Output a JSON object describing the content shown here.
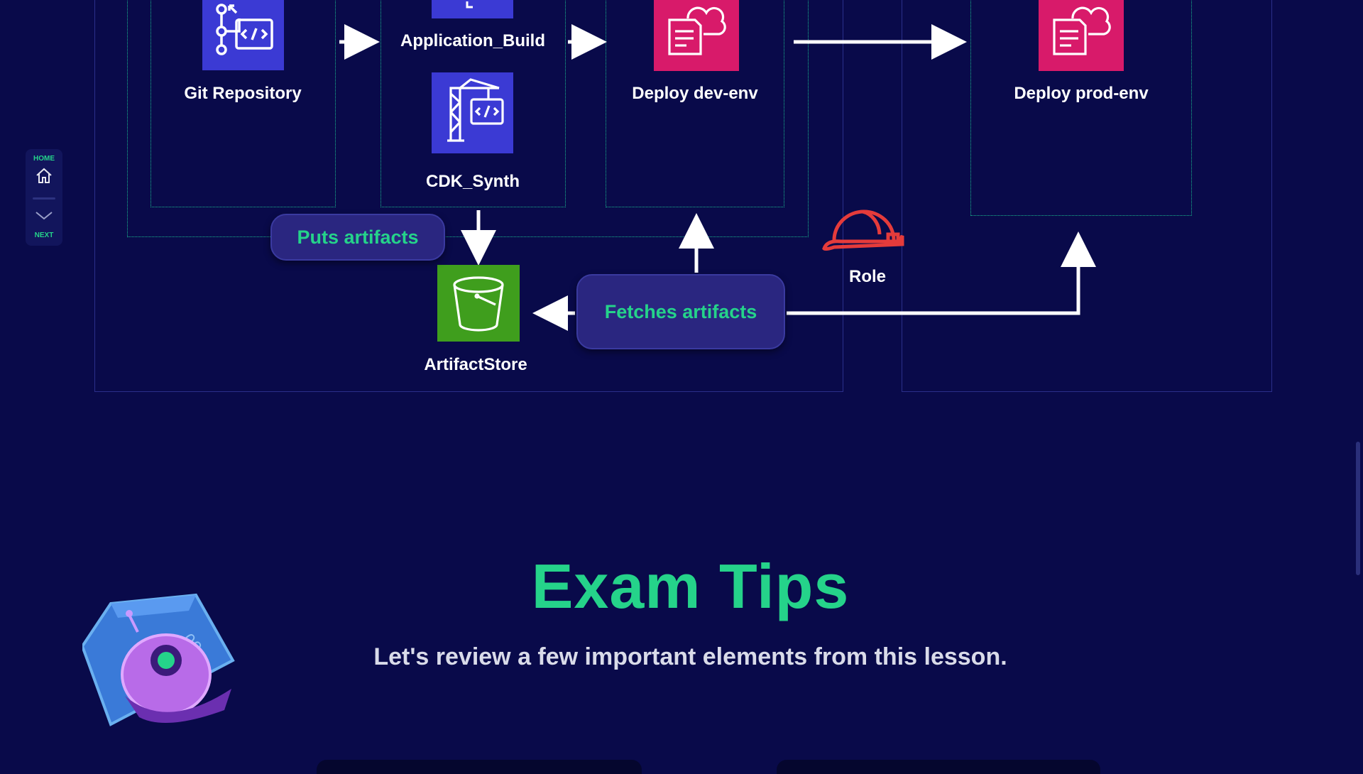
{
  "nav": {
    "home_label": "HOME",
    "next_label": "NEXT"
  },
  "diagram": {
    "nodes": {
      "git_repository": "Git Repository",
      "application_build": "Application_Build",
      "cdk_synth": "CDK_Synth",
      "deploy_dev": "Deploy dev-env",
      "deploy_prod": "Deploy prod-env",
      "artifact_store": "ArtifactStore",
      "role": "Role"
    },
    "pills": {
      "puts_artifacts": "Puts artifacts",
      "fetches_artifacts": "Fetches artifacts"
    }
  },
  "section": {
    "title": "Exam Tips",
    "subtitle": "Let's review a few important elements from this lesson."
  },
  "colors": {
    "background": "#090a4a",
    "accent_green": "#25d38a",
    "dev_tools_blue": "#3b3ad4",
    "deploy_pink": "#d81a6a",
    "storage_green": "#3f9e1d",
    "role_red": "#e53b3b"
  },
  "icons": [
    "home-icon",
    "chevron-down-icon",
    "codecommit-icon",
    "codebuild-icon",
    "codedeploy-icon",
    "s3-bucket-icon",
    "hard-hat-icon",
    "mascot-robot-icon"
  ]
}
